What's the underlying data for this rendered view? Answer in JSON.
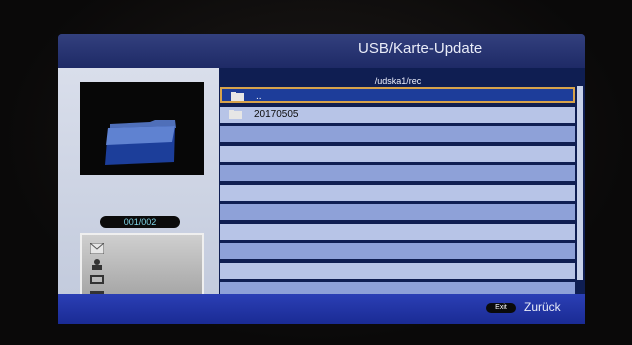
{
  "title": "USB/Karte-Update",
  "current_path": "/udska1/rec",
  "file_counter": "001/002",
  "file_list": [
    {
      "label": "..",
      "selected": true
    },
    {
      "label": "20170505",
      "selected": false
    }
  ],
  "media_icons": [
    "mail-icon",
    "person-icon",
    "tv-icon",
    "photo-icon"
  ],
  "footer": {
    "exit_key": "Exit",
    "back_label": "Zurück"
  },
  "colors": {
    "accent": "#1d3d9a",
    "selection_border": "#d8a34b",
    "panel_bg": "#1a2a6c"
  }
}
